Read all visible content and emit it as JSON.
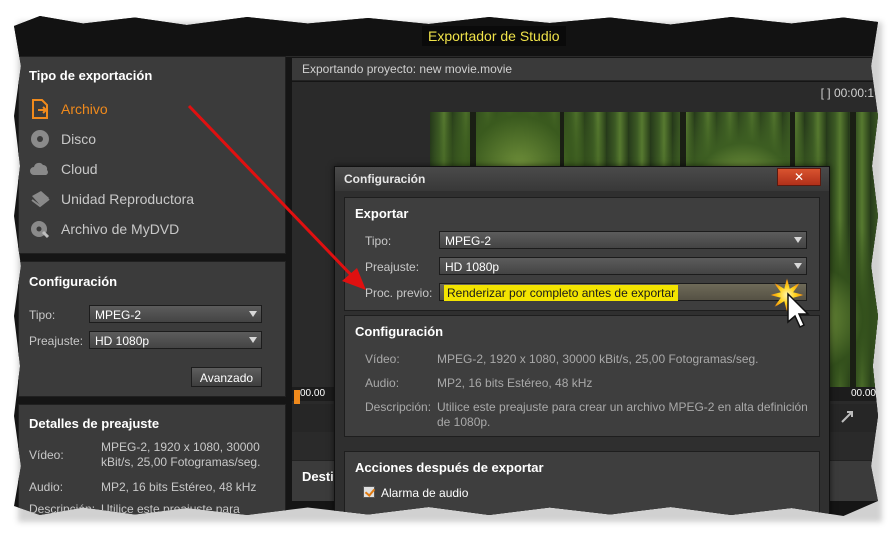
{
  "window": {
    "title": "Exportador de Studio"
  },
  "export_type": {
    "heading": "Tipo de exportación",
    "items": [
      {
        "label": "Archivo",
        "icon": "file-export-icon",
        "active": true
      },
      {
        "label": "Disco",
        "icon": "disc-icon"
      },
      {
        "label": "Cloud",
        "icon": "cloud-icon"
      },
      {
        "label": "Unidad Reproductora",
        "icon": "device-icon"
      },
      {
        "label": "Archivo de MyDVD",
        "icon": "mydvd-icon"
      }
    ]
  },
  "config": {
    "heading": "Configuración",
    "type_label": "Tipo:",
    "type_value": "MPEG-2",
    "preset_label": "Preajuste:",
    "preset_value": "HD 1080p",
    "advanced_button": "Avanzado"
  },
  "preset_details": {
    "heading": "Detalles de preajuste",
    "video_label": "Vídeo:",
    "video_value": "MPEG-2, 1920 x 1080, 30000 kBit/s, 25,00 Fotogramas/seg.",
    "audio_label": "Audio:",
    "audio_value": "MP2, 16 bits Estéreo, 48 kHz",
    "desc_label": "Descripción:",
    "desc_value": "Utilice este preajuste para"
  },
  "preview": {
    "exporting_text": "Exportando proyecto: new movie.movie",
    "timecode": "[ ] 00:00:1",
    "time_start": "00.00",
    "time_end": "00.00",
    "destination_partial": "Desti"
  },
  "dialog": {
    "title": "Configuración",
    "close": "✕",
    "export_section": {
      "heading": "Exportar",
      "type_label": "Tipo:",
      "type_value": "MPEG-2",
      "preset_label": "Preajuste:",
      "preset_value": "HD 1080p",
      "preproc_label": "Proc. previo:",
      "preproc_value": "Renderizar por completo antes de exportar"
    },
    "config_section": {
      "heading": "Configuración",
      "video_label": "Vídeo:",
      "video_value": "MPEG-2, 1920 x 1080, 30000 kBit/s, 25,00 Fotogramas/seg.",
      "audio_label": "Audio:",
      "audio_value": "MP2, 16 bits Estéreo, 48 kHz",
      "desc_label": "Descripción:",
      "desc_value": "Utilice este preajuste para crear un archivo MPEG-2 en alta definición de 1080p."
    },
    "after_section": {
      "heading": "Acciones después de exportar",
      "audio_alarm": "Alarma de audio",
      "audio_alarm_checked": true
    }
  },
  "colors": {
    "accent": "#f08a1c",
    "title_text": "#f0e34a",
    "highlight": "#f3e400",
    "arrow": "#e01010"
  }
}
